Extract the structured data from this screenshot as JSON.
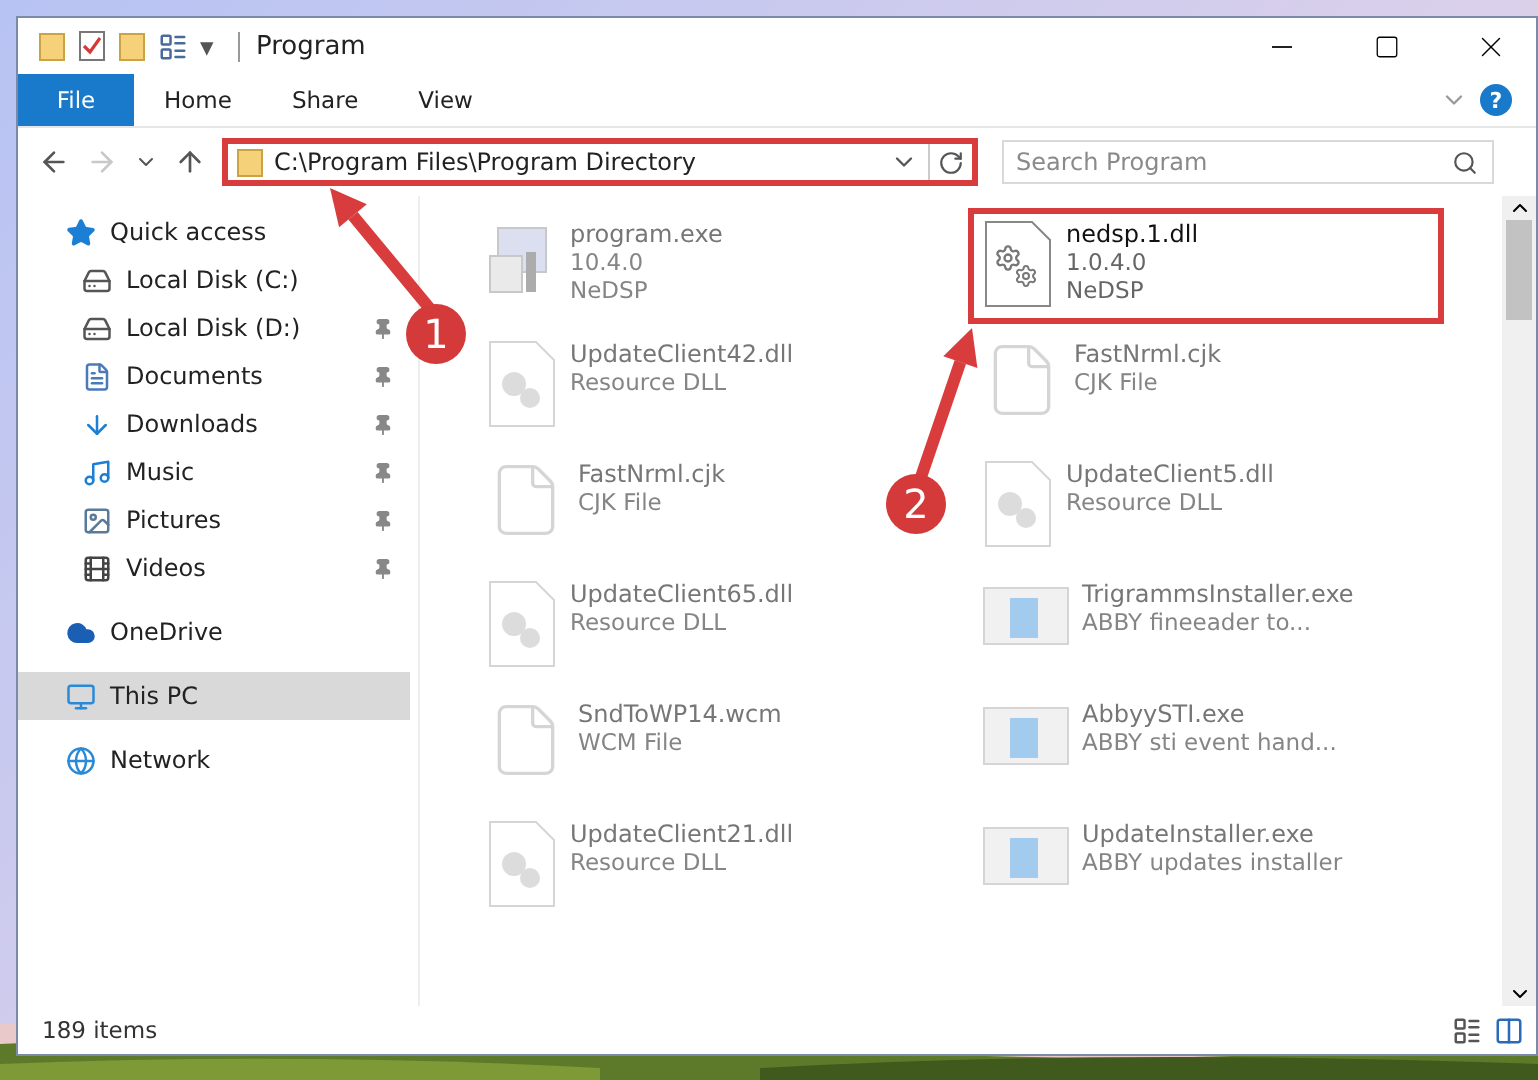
{
  "window": {
    "title": "Program"
  },
  "quick_toolbar": {
    "caret": "▾"
  },
  "ribbon": {
    "tabs": [
      {
        "label": "File",
        "selected": true
      },
      {
        "label": "Home",
        "selected": false
      },
      {
        "label": "Share",
        "selected": false
      },
      {
        "label": "View",
        "selected": false
      }
    ],
    "help": "?"
  },
  "address_bar": {
    "path": "C:\\Program Files\\Program Directory",
    "highlighted": true,
    "forward_disabled": true
  },
  "search": {
    "placeholder": "Search Program"
  },
  "sidebar": {
    "items": [
      {
        "label": "Quick access",
        "kind": "star",
        "pinned": false,
        "selected": false,
        "group": true
      },
      {
        "label": "Local Disk (C:)",
        "kind": "disk-c",
        "pinned": false,
        "selected": false,
        "group": false
      },
      {
        "label": "Local Disk (D:)",
        "kind": "disk",
        "pinned": true,
        "selected": false,
        "group": false
      },
      {
        "label": "Documents",
        "kind": "documents",
        "pinned": true,
        "selected": false,
        "group": false
      },
      {
        "label": "Downloads",
        "kind": "downloads",
        "pinned": true,
        "selected": false,
        "group": false
      },
      {
        "label": "Music",
        "kind": "music",
        "pinned": true,
        "selected": false,
        "group": false
      },
      {
        "label": "Pictures",
        "kind": "pictures",
        "pinned": true,
        "selected": false,
        "group": false
      },
      {
        "label": "Videos",
        "kind": "videos",
        "pinned": true,
        "selected": false,
        "group": false
      },
      {
        "label": "OneDrive",
        "kind": "cloud",
        "pinned": false,
        "selected": false,
        "group": true
      },
      {
        "label": "This PC",
        "kind": "pc",
        "pinned": false,
        "selected": true,
        "group": true
      },
      {
        "label": "Network",
        "kind": "network",
        "pinned": false,
        "selected": false,
        "group": true
      }
    ]
  },
  "files": [
    {
      "name": "program.exe",
      "details": [
        "10.4.0",
        "NeDSP"
      ],
      "kind": "exe",
      "faded": true,
      "highlighted": false
    },
    {
      "name": "nedsp.1.dll",
      "details": [
        "1.0.4.0",
        "NeDSP"
      ],
      "kind": "gear",
      "faded": false,
      "highlighted": true
    },
    {
      "name": "UpdateClient42.dll",
      "details": [
        "Resource DLL"
      ],
      "kind": "resource",
      "faded": true,
      "highlighted": false
    },
    {
      "name": "FastNrml.cjk",
      "details": [
        "CJK File"
      ],
      "kind": "blank",
      "faded": true,
      "highlighted": false
    },
    {
      "name": "FastNrml.cjk",
      "details": [
        "CJK File"
      ],
      "kind": "blank",
      "faded": true,
      "highlighted": false
    },
    {
      "name": "UpdateClient5.dll",
      "details": [
        "Resource DLL"
      ],
      "kind": "resource",
      "faded": true,
      "highlighted": false
    },
    {
      "name": "UpdateClient65.dll",
      "details": [
        "Resource DLL"
      ],
      "kind": "resource",
      "faded": true,
      "highlighted": false
    },
    {
      "name": "TrigrammsInstaller.exe",
      "details": [
        "ABBY fineeader to..."
      ],
      "kind": "app",
      "faded": true,
      "highlighted": false
    },
    {
      "name": "SndToWP14.wcm",
      "details": [
        "WCM File"
      ],
      "kind": "blank",
      "faded": true,
      "highlighted": false
    },
    {
      "name": "AbbyySTI.exe",
      "details": [
        "ABBY sti event hand..."
      ],
      "kind": "app",
      "faded": true,
      "highlighted": false
    },
    {
      "name": "UpdateClient21.dll",
      "details": [
        "Resource DLL"
      ],
      "kind": "resource",
      "faded": true,
      "highlighted": false
    },
    {
      "name": "UpdateInstaller.exe",
      "details": [
        "ABBY updates installer"
      ],
      "kind": "app",
      "faded": true,
      "highlighted": false
    }
  ],
  "status_bar": {
    "count": "189 items"
  },
  "callouts": [
    {
      "number": "1"
    },
    {
      "number": "2"
    }
  ]
}
